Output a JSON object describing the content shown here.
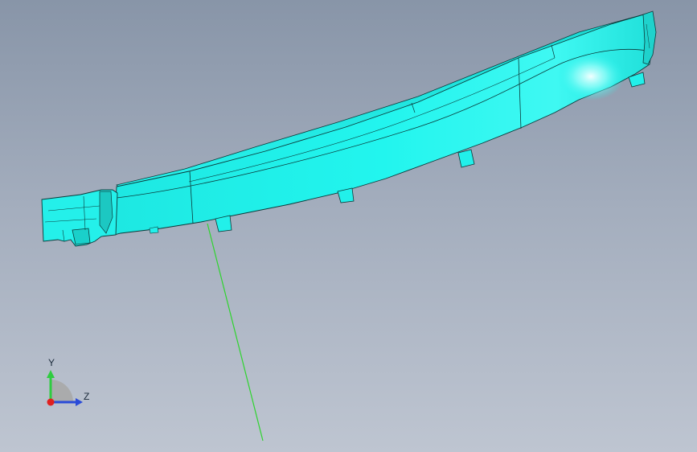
{
  "viewport": {
    "background_top": "#8895a8",
    "background_bottom": "#bec5d1"
  },
  "model": {
    "body_color": "#22f5ee",
    "edge_color": "#0b3a3a",
    "highlight_color": "#e8ffff"
  },
  "triad": {
    "y_label": "Y",
    "z_label": "Z",
    "y_color": "#2fcc40",
    "z_color": "#2a4bd8",
    "x_color": "#e02020"
  },
  "reference_line_color": "#2ed42e"
}
